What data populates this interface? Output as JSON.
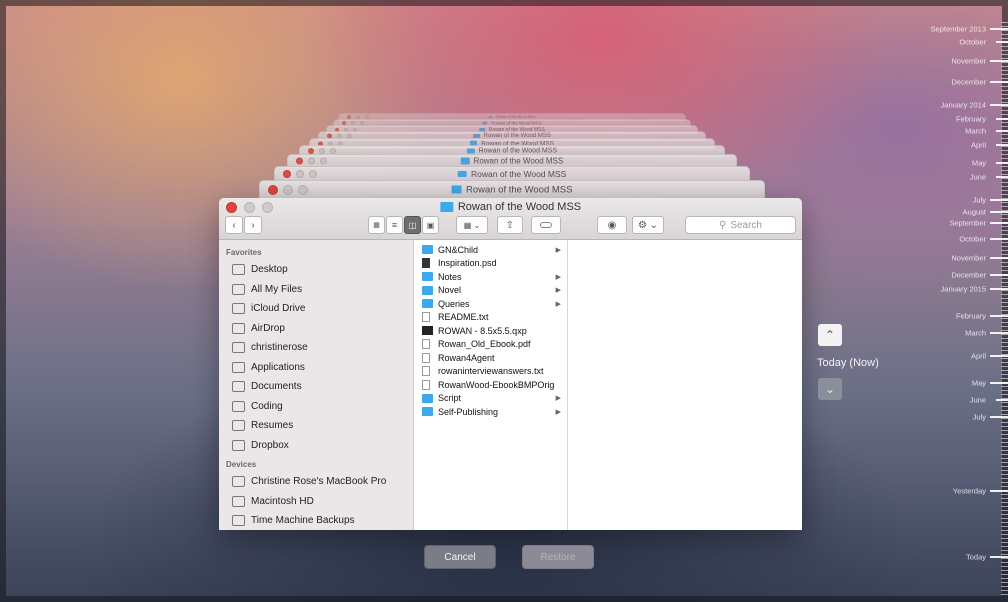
{
  "window": {
    "title": "Rowan of the Wood MSS",
    "search_placeholder": "Search"
  },
  "toolbar": {
    "back_icon": "chevron-left-icon",
    "forward_icon": "chevron-right-icon",
    "view_icons": [
      "icon-view-icon",
      "list-view-icon",
      "column-view-icon",
      "coverflow-view-icon"
    ],
    "arrange_icon": "arrange-icon",
    "share_icon": "share-icon",
    "tag_icon": "tag-icon",
    "quicklook_icon": "eye-icon",
    "action_icon": "gear-icon"
  },
  "sidebar": {
    "favorites_header": "Favorites",
    "favorites": [
      {
        "label": "Desktop",
        "icon": "desktop-icon"
      },
      {
        "label": "All My Files",
        "icon": "all-files-icon"
      },
      {
        "label": "iCloud Drive",
        "icon": "cloud-icon"
      },
      {
        "label": "AirDrop",
        "icon": "airdrop-icon"
      },
      {
        "label": "christinerose",
        "icon": "home-icon"
      },
      {
        "label": "Applications",
        "icon": "applications-icon"
      },
      {
        "label": "Documents",
        "icon": "documents-icon"
      },
      {
        "label": "Coding",
        "icon": "folder-icon"
      },
      {
        "label": "Resumes",
        "icon": "folder-icon"
      },
      {
        "label": "Dropbox",
        "icon": "folder-icon"
      }
    ],
    "devices_header": "Devices",
    "devices": [
      {
        "label": "Christine Rose's MacBook Pro",
        "icon": "laptop-icon"
      },
      {
        "label": "Macintosh HD",
        "icon": "hard-drive-icon"
      },
      {
        "label": "Time Machine Backups",
        "icon": "time-machine-icon"
      }
    ]
  },
  "files": [
    {
      "name": "GN&Child",
      "type": "folder",
      "has_children": true
    },
    {
      "name": "Inspiration.psd",
      "type": "psd",
      "has_children": false
    },
    {
      "name": "Notes",
      "type": "folder",
      "has_children": true
    },
    {
      "name": "Novel",
      "type": "folder",
      "has_children": true
    },
    {
      "name": "Queries",
      "type": "folder",
      "has_children": true
    },
    {
      "name": "README.txt",
      "type": "doc",
      "has_children": false
    },
    {
      "name": "ROWAN - 8.5x5.5.qxp",
      "type": "dark",
      "has_children": false
    },
    {
      "name": "Rowan_Old_Ebook.pdf",
      "type": "pdf",
      "has_children": false
    },
    {
      "name": "Rowan4Agent",
      "type": "doc",
      "has_children": false
    },
    {
      "name": "rowaninterviewanswers.txt",
      "type": "doc",
      "has_children": false
    },
    {
      "name": "RowanWood-EbookBMPOrig",
      "type": "pdf",
      "has_children": false
    },
    {
      "name": "Script",
      "type": "folder",
      "has_children": true
    },
    {
      "name": "Self-Publishing",
      "type": "folder",
      "has_children": true
    }
  ],
  "buttons": {
    "cancel": "Cancel",
    "restore": "Restore"
  },
  "navigation": {
    "current": "Today (Now)",
    "up_icon": "chevron-up-icon",
    "down_icon": "chevron-down-icon"
  },
  "timeline": [
    "September 2013",
    "October",
    "November",
    "December",
    "January 2014",
    "February",
    "March",
    "April",
    "May",
    "June",
    "July",
    "August",
    "September",
    "October",
    "November",
    "December",
    "January 2015",
    "February",
    "March",
    "April",
    "May",
    "June",
    "July",
    "Yesterday",
    "Today"
  ]
}
